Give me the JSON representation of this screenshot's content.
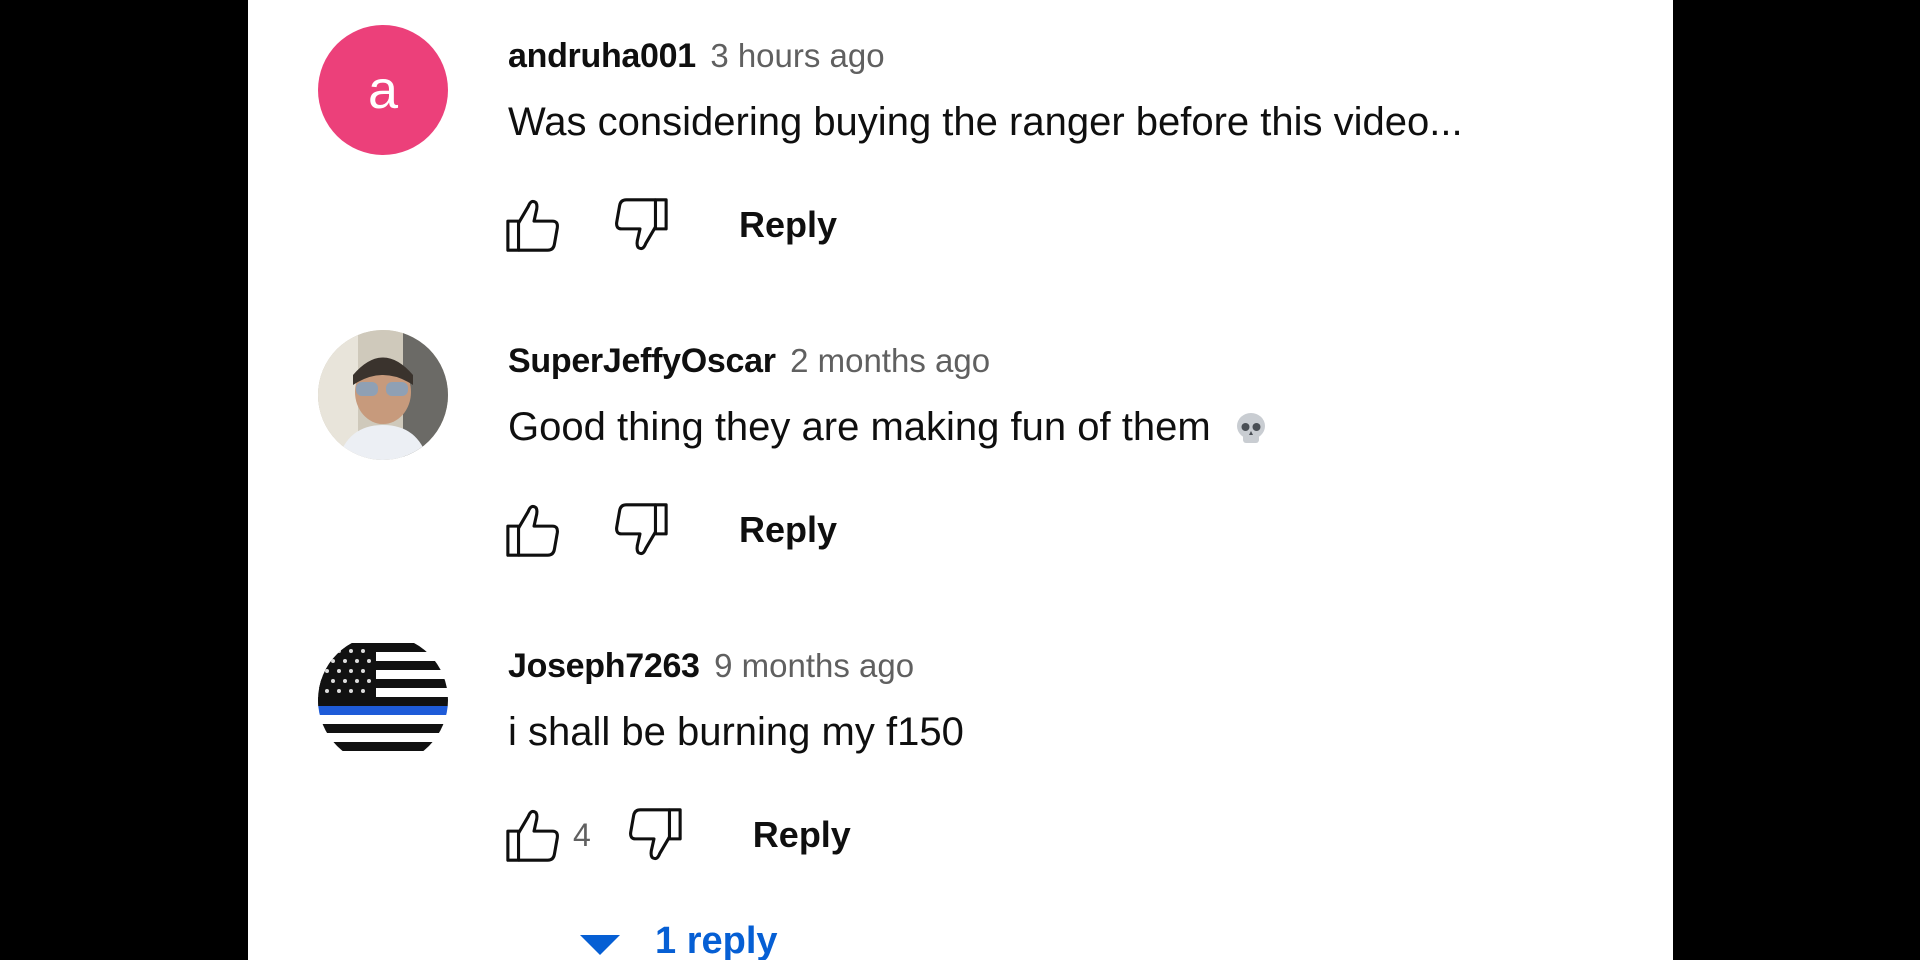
{
  "comments": [
    {
      "author": "andruha001",
      "time": "3 hours ago",
      "text": "Was considering buying the ranger before this video...",
      "avatar_letter": "a",
      "avatar_color": "#ec407a",
      "like_count": "",
      "reply_label": "Reply"
    },
    {
      "author": "SuperJeffyOscar",
      "time": "2 months ago",
      "text": "Good thing they are making fun of them",
      "emoji": "skull-icon",
      "like_count": "",
      "reply_label": "Reply"
    },
    {
      "author": "Joseph7263",
      "time": "9 months ago",
      "text": "i shall be burning my f150",
      "like_count": "4",
      "reply_label": "Reply",
      "replies_label": "1 reply"
    }
  ],
  "colors": {
    "link": "#065fd4",
    "avatar_pink": "#ec407a",
    "flag_stripe": "#1e5bd8"
  }
}
